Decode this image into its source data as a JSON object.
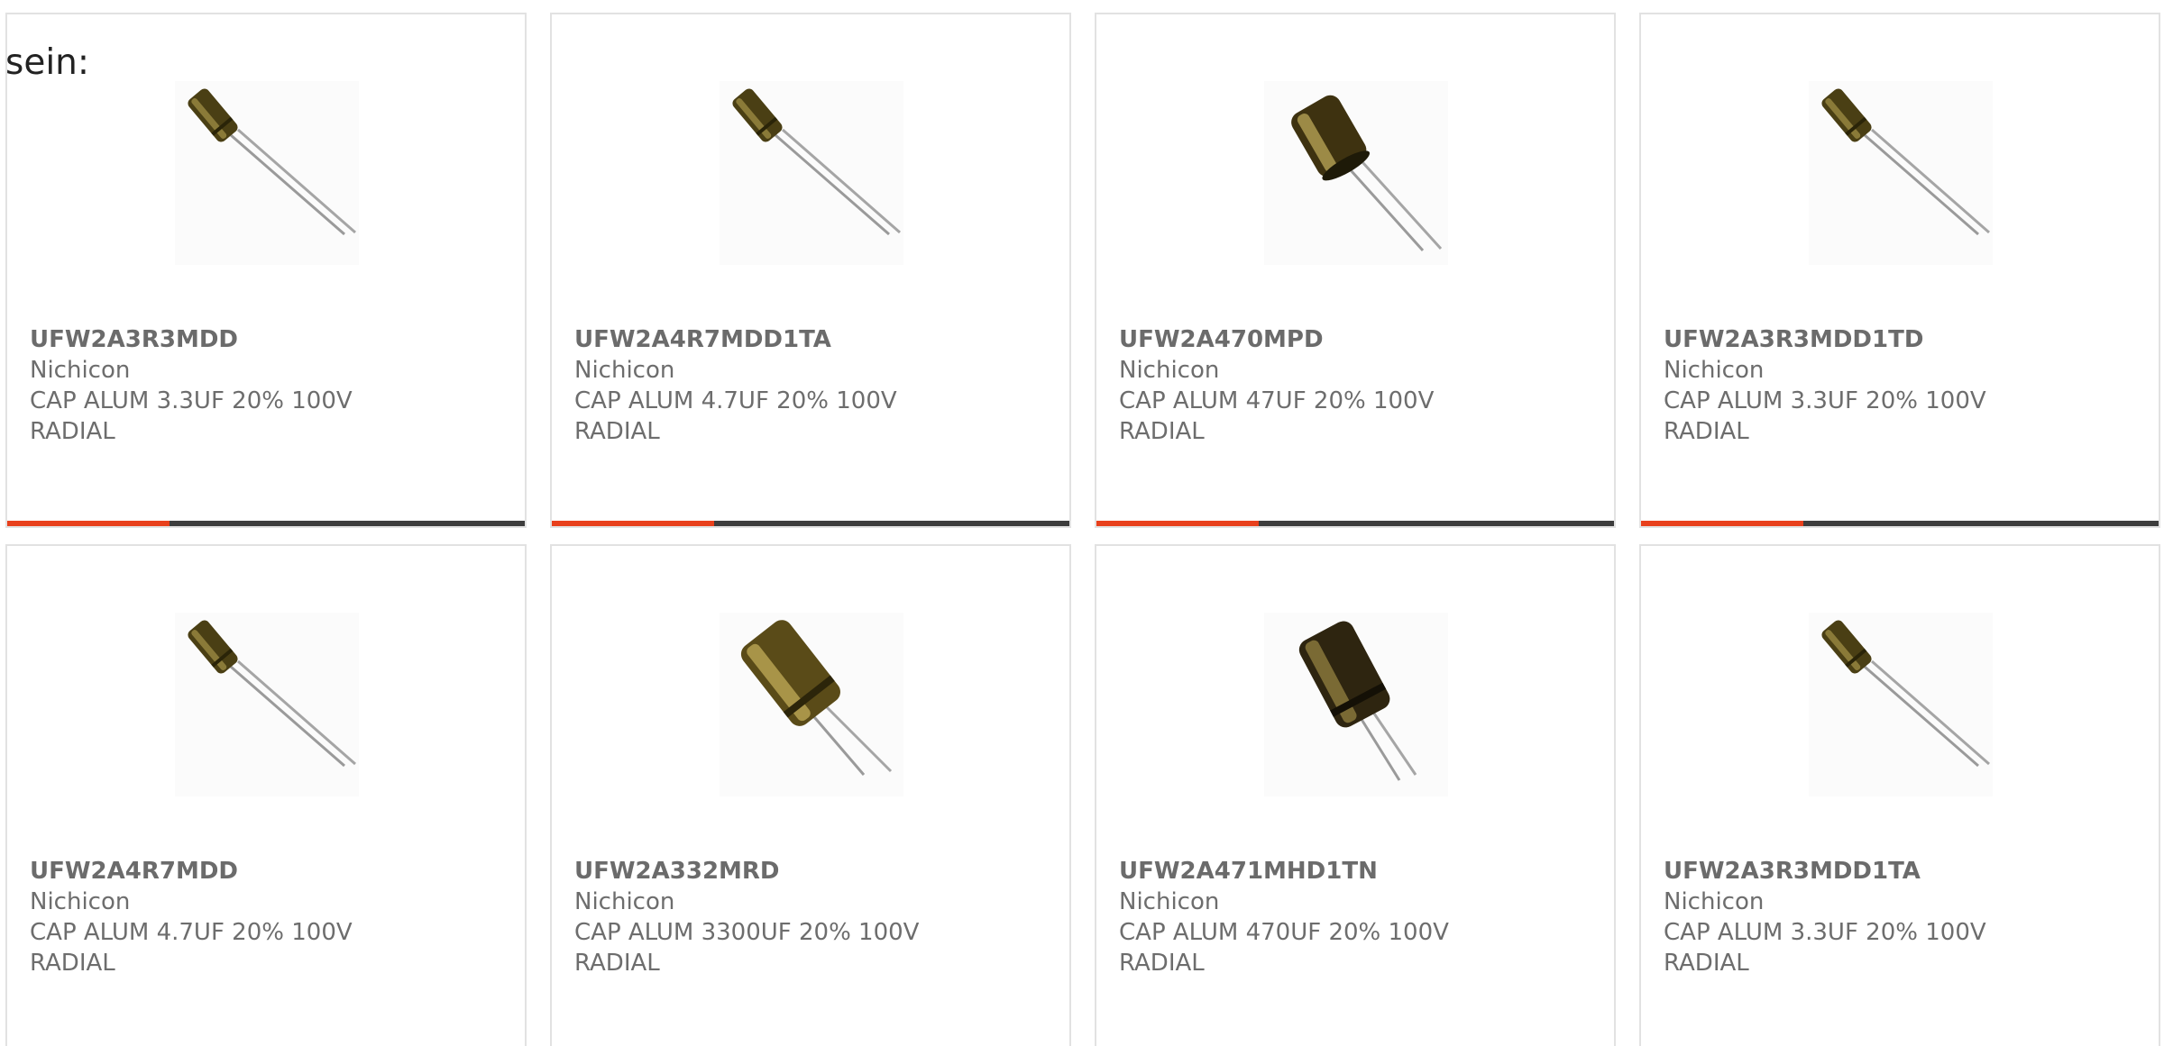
{
  "intro_text": "sein:",
  "colors": {
    "accent": "#e8401c",
    "bar": "#3d3d3d",
    "text": "#6d6d6d",
    "border": "#e2e2e2"
  },
  "products": [
    {
      "part": "UFW2A3R3MDD",
      "maker": "Nichicon",
      "desc": "CAP ALUM 3.3UF 20% 100V",
      "pkg": "RADIAL",
      "image": "small-radial-capacitor"
    },
    {
      "part": "UFW2A4R7MDD1TA",
      "maker": "Nichicon",
      "desc": "CAP ALUM 4.7UF 20% 100V",
      "pkg": "RADIAL",
      "image": "small-radial-capacitor"
    },
    {
      "part": "UFW2A470MPD",
      "maker": "Nichicon",
      "desc": "CAP ALUM 47UF 20% 100V",
      "pkg": "RADIAL",
      "image": "medium-radial-capacitor"
    },
    {
      "part": "UFW2A3R3MDD1TD",
      "maker": "Nichicon",
      "desc": "CAP ALUM 3.3UF 20% 100V",
      "pkg": "RADIAL",
      "image": "small-radial-capacitor"
    },
    {
      "part": "UFW2A4R7MDD",
      "maker": "Nichicon",
      "desc": "CAP ALUM 4.7UF 20% 100V",
      "pkg": "RADIAL",
      "image": "small-radial-capacitor"
    },
    {
      "part": "UFW2A332MRD",
      "maker": "Nichicon",
      "desc": "CAP ALUM 3300UF 20% 100V",
      "pkg": "RADIAL",
      "image": "large-radial-capacitor"
    },
    {
      "part": "UFW2A471MHD1TN",
      "maker": "Nichicon",
      "desc": "CAP ALUM 470UF 20% 100V",
      "pkg": "RADIAL",
      "image": "large-radial-capacitor"
    },
    {
      "part": "UFW2A3R3MDD1TA",
      "maker": "Nichicon",
      "desc": "CAP ALUM 3.3UF 20% 100V",
      "pkg": "RADIAL",
      "image": "small-radial-capacitor"
    }
  ]
}
